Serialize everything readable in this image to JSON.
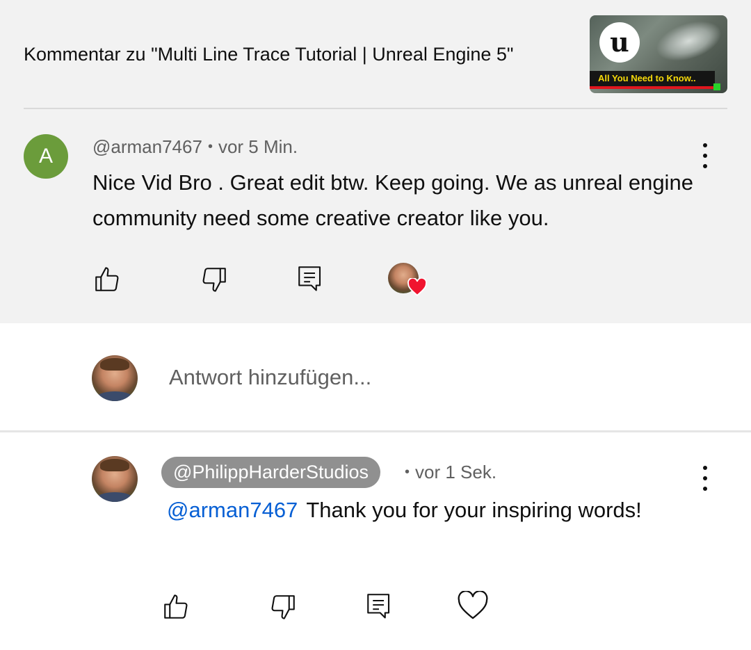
{
  "header": {
    "context_title": "Kommentar zu \"Multi Line Trace Tutorial | Unreal Engine 5\"",
    "thumbnail": {
      "logo_glyph": "u",
      "banner_text": "All You Need to Know.."
    }
  },
  "comment": {
    "avatar_letter": "A",
    "avatar_color": "#6b9c3b",
    "author": "@arman7467",
    "separator": "•",
    "time": "vor 5 Min.",
    "text": "Nice Vid Bro . Great edit btw. Keep going. We as unreal engine community need some creative creator like you.",
    "actions": {
      "like_icon": "thumb-up-icon",
      "dislike_icon": "thumb-down-icon",
      "reply_icon": "comment-reply-icon",
      "hearted": "creator-heart-icon"
    }
  },
  "reply_box": {
    "placeholder": "Antwort hinzufügen..."
  },
  "reply": {
    "author": "@PhilippHarderStudios",
    "separator": "•",
    "time": "vor 1 Sek.",
    "mention": "@arman7467",
    "text_after_mention": "Thank you for your inspiring words!",
    "actions": {
      "like_icon": "thumb-up-icon",
      "dislike_icon": "thumb-down-icon",
      "reply_icon": "comment-reply-icon",
      "heart_icon": "heart-outline-icon"
    }
  },
  "colors": {
    "top_background": "#f2f2f2",
    "secondary_text": "#606060",
    "mention_link": "#065fd4",
    "heart_red": "#f0142f",
    "badge_gray": "#909090"
  }
}
